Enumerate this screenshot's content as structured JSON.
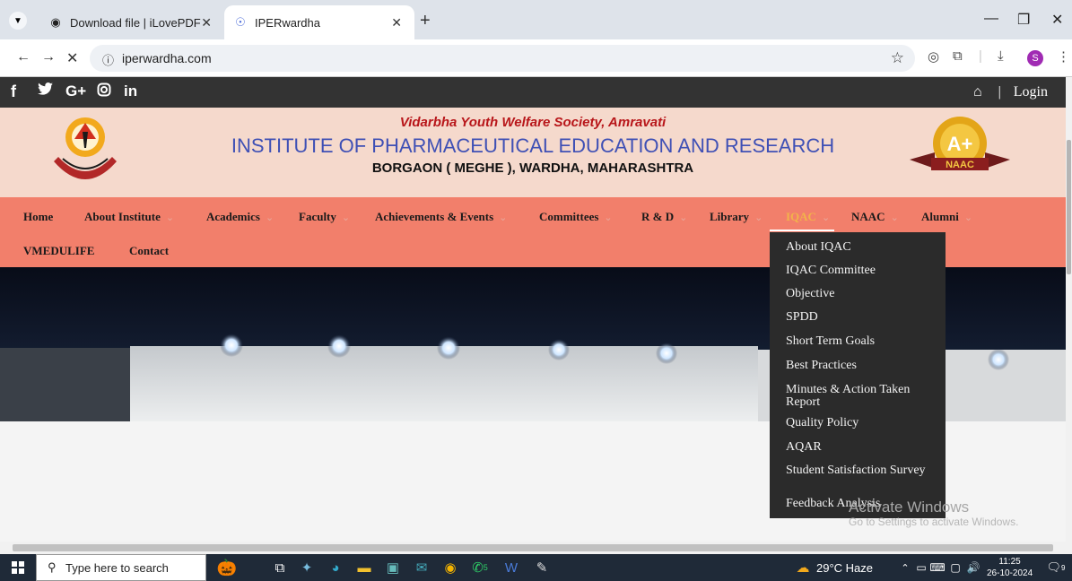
{
  "browser": {
    "tabs": [
      {
        "title": "Download file | iLovePDF",
        "icon": "pdf-favicon"
      },
      {
        "title": "IPERwardha",
        "icon": "site-favicon",
        "active": true
      }
    ],
    "url": "iperwardha.com"
  },
  "site": {
    "social_icons": [
      "facebook-icon",
      "twitter-icon",
      "google-plus-icon",
      "instagram-icon",
      "linkedin-icon"
    ],
    "login": "Login",
    "separator": "|",
    "header": {
      "society": "Vidarbha Youth Welfare Society, Amravati",
      "institute": "INSTITUTE OF PHARMACEUTICAL EDUCATION AND RESEARCH",
      "address": "BORGAON ( MEGHE ), WARDHA, MAHARASHTRA",
      "naac_grade": "A+",
      "naac_label": "NAAC"
    },
    "nav": [
      {
        "label": "Home"
      },
      {
        "label": "About Institute"
      },
      {
        "label": "Academics"
      },
      {
        "label": "Faculty"
      },
      {
        "label": "Achievements & Events"
      },
      {
        "label": "Committees"
      },
      {
        "label": "R & D"
      },
      {
        "label": "Library"
      },
      {
        "label": "IQAC"
      },
      {
        "label": "NAAC"
      },
      {
        "label": "Alumni"
      },
      {
        "label": "VMEDULIFE"
      },
      {
        "label": "Contact"
      }
    ],
    "iqac_menu": [
      "About IQAC",
      "IQAC Committee",
      "Objective",
      "SPDD",
      "Short Term Goals",
      "Best Practices",
      "Minutes & Action Taken Report",
      "Quality Policy",
      "AQAR",
      "Student Satisfaction Survey",
      "Feedback Analysis"
    ]
  },
  "watermark": {
    "line1": "Activate Windows",
    "line2": "Go to Settings to activate Windows."
  },
  "taskbar": {
    "search_placeholder": "Type here to search",
    "weather": "29°C  Haze",
    "time": "11:25",
    "date": "26-10-2024",
    "notification_count": "9",
    "whatsapp_badge": "5"
  },
  "colors": {
    "navbar": "#f27f6b",
    "header_bg": "#f5d9cc",
    "institute_title": "#3f50b5",
    "society_title": "#b8161a",
    "active_nav": "#f2b34a"
  }
}
